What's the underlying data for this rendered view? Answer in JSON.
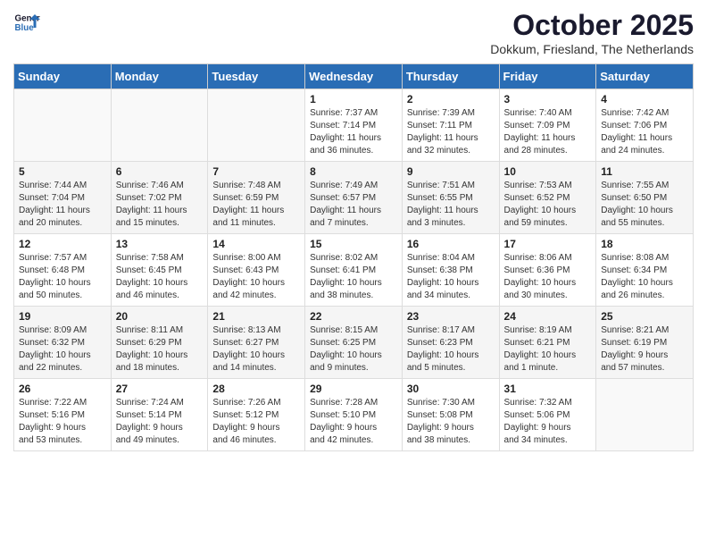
{
  "header": {
    "logo_general": "General",
    "logo_blue": "Blue",
    "month": "October 2025",
    "location": "Dokkum, Friesland, The Netherlands"
  },
  "weekdays": [
    "Sunday",
    "Monday",
    "Tuesday",
    "Wednesday",
    "Thursday",
    "Friday",
    "Saturday"
  ],
  "weeks": [
    [
      {
        "day": "",
        "info": ""
      },
      {
        "day": "",
        "info": ""
      },
      {
        "day": "",
        "info": ""
      },
      {
        "day": "1",
        "info": "Sunrise: 7:37 AM\nSunset: 7:14 PM\nDaylight: 11 hours\nand 36 minutes."
      },
      {
        "day": "2",
        "info": "Sunrise: 7:39 AM\nSunset: 7:11 PM\nDaylight: 11 hours\nand 32 minutes."
      },
      {
        "day": "3",
        "info": "Sunrise: 7:40 AM\nSunset: 7:09 PM\nDaylight: 11 hours\nand 28 minutes."
      },
      {
        "day": "4",
        "info": "Sunrise: 7:42 AM\nSunset: 7:06 PM\nDaylight: 11 hours\nand 24 minutes."
      }
    ],
    [
      {
        "day": "5",
        "info": "Sunrise: 7:44 AM\nSunset: 7:04 PM\nDaylight: 11 hours\nand 20 minutes."
      },
      {
        "day": "6",
        "info": "Sunrise: 7:46 AM\nSunset: 7:02 PM\nDaylight: 11 hours\nand 15 minutes."
      },
      {
        "day": "7",
        "info": "Sunrise: 7:48 AM\nSunset: 6:59 PM\nDaylight: 11 hours\nand 11 minutes."
      },
      {
        "day": "8",
        "info": "Sunrise: 7:49 AM\nSunset: 6:57 PM\nDaylight: 11 hours\nand 7 minutes."
      },
      {
        "day": "9",
        "info": "Sunrise: 7:51 AM\nSunset: 6:55 PM\nDaylight: 11 hours\nand 3 minutes."
      },
      {
        "day": "10",
        "info": "Sunrise: 7:53 AM\nSunset: 6:52 PM\nDaylight: 10 hours\nand 59 minutes."
      },
      {
        "day": "11",
        "info": "Sunrise: 7:55 AM\nSunset: 6:50 PM\nDaylight: 10 hours\nand 55 minutes."
      }
    ],
    [
      {
        "day": "12",
        "info": "Sunrise: 7:57 AM\nSunset: 6:48 PM\nDaylight: 10 hours\nand 50 minutes."
      },
      {
        "day": "13",
        "info": "Sunrise: 7:58 AM\nSunset: 6:45 PM\nDaylight: 10 hours\nand 46 minutes."
      },
      {
        "day": "14",
        "info": "Sunrise: 8:00 AM\nSunset: 6:43 PM\nDaylight: 10 hours\nand 42 minutes."
      },
      {
        "day": "15",
        "info": "Sunrise: 8:02 AM\nSunset: 6:41 PM\nDaylight: 10 hours\nand 38 minutes."
      },
      {
        "day": "16",
        "info": "Sunrise: 8:04 AM\nSunset: 6:38 PM\nDaylight: 10 hours\nand 34 minutes."
      },
      {
        "day": "17",
        "info": "Sunrise: 8:06 AM\nSunset: 6:36 PM\nDaylight: 10 hours\nand 30 minutes."
      },
      {
        "day": "18",
        "info": "Sunrise: 8:08 AM\nSunset: 6:34 PM\nDaylight: 10 hours\nand 26 minutes."
      }
    ],
    [
      {
        "day": "19",
        "info": "Sunrise: 8:09 AM\nSunset: 6:32 PM\nDaylight: 10 hours\nand 22 minutes."
      },
      {
        "day": "20",
        "info": "Sunrise: 8:11 AM\nSunset: 6:29 PM\nDaylight: 10 hours\nand 18 minutes."
      },
      {
        "day": "21",
        "info": "Sunrise: 8:13 AM\nSunset: 6:27 PM\nDaylight: 10 hours\nand 14 minutes."
      },
      {
        "day": "22",
        "info": "Sunrise: 8:15 AM\nSunset: 6:25 PM\nDaylight: 10 hours\nand 9 minutes."
      },
      {
        "day": "23",
        "info": "Sunrise: 8:17 AM\nSunset: 6:23 PM\nDaylight: 10 hours\nand 5 minutes."
      },
      {
        "day": "24",
        "info": "Sunrise: 8:19 AM\nSunset: 6:21 PM\nDaylight: 10 hours\nand 1 minute."
      },
      {
        "day": "25",
        "info": "Sunrise: 8:21 AM\nSunset: 6:19 PM\nDaylight: 9 hours\nand 57 minutes."
      }
    ],
    [
      {
        "day": "26",
        "info": "Sunrise: 7:22 AM\nSunset: 5:16 PM\nDaylight: 9 hours\nand 53 minutes."
      },
      {
        "day": "27",
        "info": "Sunrise: 7:24 AM\nSunset: 5:14 PM\nDaylight: 9 hours\nand 49 minutes."
      },
      {
        "day": "28",
        "info": "Sunrise: 7:26 AM\nSunset: 5:12 PM\nDaylight: 9 hours\nand 46 minutes."
      },
      {
        "day": "29",
        "info": "Sunrise: 7:28 AM\nSunset: 5:10 PM\nDaylight: 9 hours\nand 42 minutes."
      },
      {
        "day": "30",
        "info": "Sunrise: 7:30 AM\nSunset: 5:08 PM\nDaylight: 9 hours\nand 38 minutes."
      },
      {
        "day": "31",
        "info": "Sunrise: 7:32 AM\nSunset: 5:06 PM\nDaylight: 9 hours\nand 34 minutes."
      },
      {
        "day": "",
        "info": ""
      }
    ]
  ]
}
